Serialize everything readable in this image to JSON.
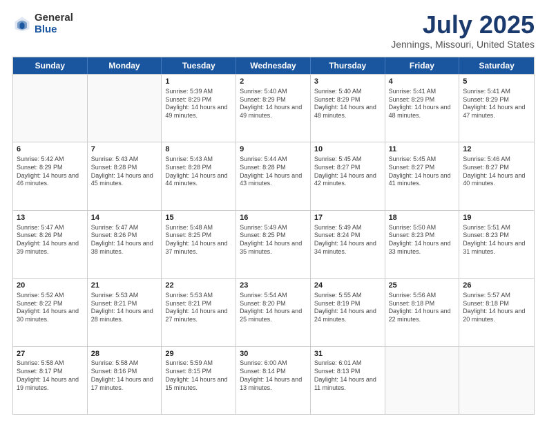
{
  "logo": {
    "general": "General",
    "blue": "Blue"
  },
  "header": {
    "month": "July 2025",
    "location": "Jennings, Missouri, United States"
  },
  "days": [
    "Sunday",
    "Monday",
    "Tuesday",
    "Wednesday",
    "Thursday",
    "Friday",
    "Saturday"
  ],
  "weeks": [
    [
      {
        "day": "",
        "empty": true
      },
      {
        "day": "",
        "empty": true
      },
      {
        "day": "1",
        "sunrise": "Sunrise: 5:39 AM",
        "sunset": "Sunset: 8:29 PM",
        "daylight": "Daylight: 14 hours and 49 minutes."
      },
      {
        "day": "2",
        "sunrise": "Sunrise: 5:40 AM",
        "sunset": "Sunset: 8:29 PM",
        "daylight": "Daylight: 14 hours and 49 minutes."
      },
      {
        "day": "3",
        "sunrise": "Sunrise: 5:40 AM",
        "sunset": "Sunset: 8:29 PM",
        "daylight": "Daylight: 14 hours and 48 minutes."
      },
      {
        "day": "4",
        "sunrise": "Sunrise: 5:41 AM",
        "sunset": "Sunset: 8:29 PM",
        "daylight": "Daylight: 14 hours and 48 minutes."
      },
      {
        "day": "5",
        "sunrise": "Sunrise: 5:41 AM",
        "sunset": "Sunset: 8:29 PM",
        "daylight": "Daylight: 14 hours and 47 minutes."
      }
    ],
    [
      {
        "day": "6",
        "sunrise": "Sunrise: 5:42 AM",
        "sunset": "Sunset: 8:29 PM",
        "daylight": "Daylight: 14 hours and 46 minutes."
      },
      {
        "day": "7",
        "sunrise": "Sunrise: 5:43 AM",
        "sunset": "Sunset: 8:28 PM",
        "daylight": "Daylight: 14 hours and 45 minutes."
      },
      {
        "day": "8",
        "sunrise": "Sunrise: 5:43 AM",
        "sunset": "Sunset: 8:28 PM",
        "daylight": "Daylight: 14 hours and 44 minutes."
      },
      {
        "day": "9",
        "sunrise": "Sunrise: 5:44 AM",
        "sunset": "Sunset: 8:28 PM",
        "daylight": "Daylight: 14 hours and 43 minutes."
      },
      {
        "day": "10",
        "sunrise": "Sunrise: 5:45 AM",
        "sunset": "Sunset: 8:27 PM",
        "daylight": "Daylight: 14 hours and 42 minutes."
      },
      {
        "day": "11",
        "sunrise": "Sunrise: 5:45 AM",
        "sunset": "Sunset: 8:27 PM",
        "daylight": "Daylight: 14 hours and 41 minutes."
      },
      {
        "day": "12",
        "sunrise": "Sunrise: 5:46 AM",
        "sunset": "Sunset: 8:27 PM",
        "daylight": "Daylight: 14 hours and 40 minutes."
      }
    ],
    [
      {
        "day": "13",
        "sunrise": "Sunrise: 5:47 AM",
        "sunset": "Sunset: 8:26 PM",
        "daylight": "Daylight: 14 hours and 39 minutes."
      },
      {
        "day": "14",
        "sunrise": "Sunrise: 5:47 AM",
        "sunset": "Sunset: 8:26 PM",
        "daylight": "Daylight: 14 hours and 38 minutes."
      },
      {
        "day": "15",
        "sunrise": "Sunrise: 5:48 AM",
        "sunset": "Sunset: 8:25 PM",
        "daylight": "Daylight: 14 hours and 37 minutes."
      },
      {
        "day": "16",
        "sunrise": "Sunrise: 5:49 AM",
        "sunset": "Sunset: 8:25 PM",
        "daylight": "Daylight: 14 hours and 35 minutes."
      },
      {
        "day": "17",
        "sunrise": "Sunrise: 5:49 AM",
        "sunset": "Sunset: 8:24 PM",
        "daylight": "Daylight: 14 hours and 34 minutes."
      },
      {
        "day": "18",
        "sunrise": "Sunrise: 5:50 AM",
        "sunset": "Sunset: 8:23 PM",
        "daylight": "Daylight: 14 hours and 33 minutes."
      },
      {
        "day": "19",
        "sunrise": "Sunrise: 5:51 AM",
        "sunset": "Sunset: 8:23 PM",
        "daylight": "Daylight: 14 hours and 31 minutes."
      }
    ],
    [
      {
        "day": "20",
        "sunrise": "Sunrise: 5:52 AM",
        "sunset": "Sunset: 8:22 PM",
        "daylight": "Daylight: 14 hours and 30 minutes."
      },
      {
        "day": "21",
        "sunrise": "Sunrise: 5:53 AM",
        "sunset": "Sunset: 8:21 PM",
        "daylight": "Daylight: 14 hours and 28 minutes."
      },
      {
        "day": "22",
        "sunrise": "Sunrise: 5:53 AM",
        "sunset": "Sunset: 8:21 PM",
        "daylight": "Daylight: 14 hours and 27 minutes."
      },
      {
        "day": "23",
        "sunrise": "Sunrise: 5:54 AM",
        "sunset": "Sunset: 8:20 PM",
        "daylight": "Daylight: 14 hours and 25 minutes."
      },
      {
        "day": "24",
        "sunrise": "Sunrise: 5:55 AM",
        "sunset": "Sunset: 8:19 PM",
        "daylight": "Daylight: 14 hours and 24 minutes."
      },
      {
        "day": "25",
        "sunrise": "Sunrise: 5:56 AM",
        "sunset": "Sunset: 8:18 PM",
        "daylight": "Daylight: 14 hours and 22 minutes."
      },
      {
        "day": "26",
        "sunrise": "Sunrise: 5:57 AM",
        "sunset": "Sunset: 8:18 PM",
        "daylight": "Daylight: 14 hours and 20 minutes."
      }
    ],
    [
      {
        "day": "27",
        "sunrise": "Sunrise: 5:58 AM",
        "sunset": "Sunset: 8:17 PM",
        "daylight": "Daylight: 14 hours and 19 minutes."
      },
      {
        "day": "28",
        "sunrise": "Sunrise: 5:58 AM",
        "sunset": "Sunset: 8:16 PM",
        "daylight": "Daylight: 14 hours and 17 minutes."
      },
      {
        "day": "29",
        "sunrise": "Sunrise: 5:59 AM",
        "sunset": "Sunset: 8:15 PM",
        "daylight": "Daylight: 14 hours and 15 minutes."
      },
      {
        "day": "30",
        "sunrise": "Sunrise: 6:00 AM",
        "sunset": "Sunset: 8:14 PM",
        "daylight": "Daylight: 14 hours and 13 minutes."
      },
      {
        "day": "31",
        "sunrise": "Sunrise: 6:01 AM",
        "sunset": "Sunset: 8:13 PM",
        "daylight": "Daylight: 14 hours and 11 minutes."
      },
      {
        "day": "",
        "empty": true
      },
      {
        "day": "",
        "empty": true
      }
    ]
  ]
}
